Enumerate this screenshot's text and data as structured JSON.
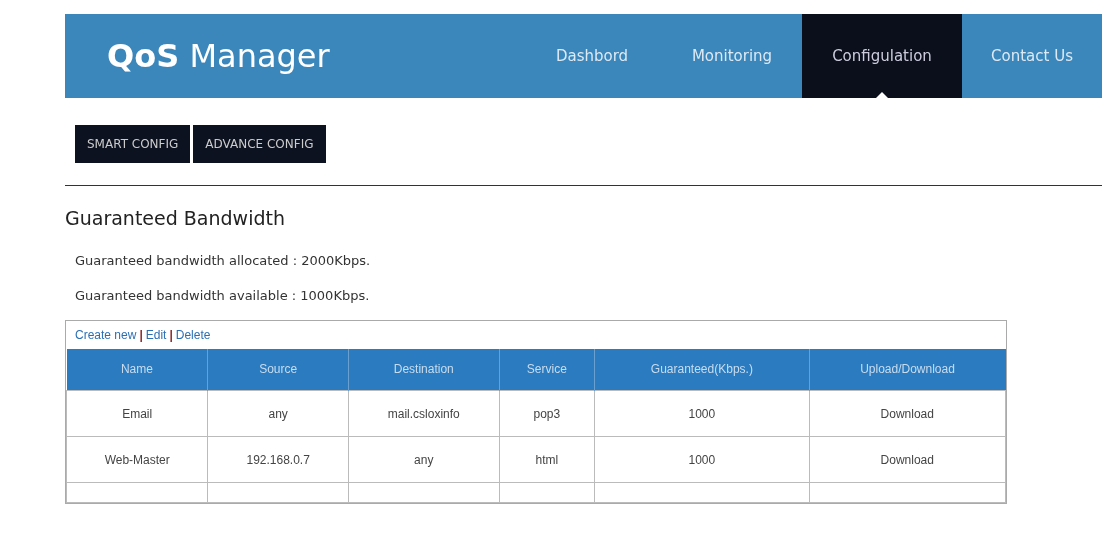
{
  "header": {
    "brand_bold": "QoS",
    "brand_light": "Manager",
    "nav": [
      {
        "label": "Dashbord",
        "selected": false
      },
      {
        "label": "Monitoring",
        "selected": false
      },
      {
        "label": "Configulation",
        "selected": true
      },
      {
        "label": "Contact Us",
        "selected": false
      }
    ]
  },
  "config_buttons": [
    "SMART CONFIG",
    "ADVANCE CONFIG"
  ],
  "section": {
    "title": "Guaranteed Bandwidth",
    "lines": [
      "Guaranteed bandwidth allocated : 2000Kbps.",
      "Guaranteed bandwidth available : 1000Kbps."
    ]
  },
  "table": {
    "actions": [
      {
        "label": "Create new"
      },
      {
        "label": "Edit"
      },
      {
        "label": "Delete"
      }
    ],
    "separators": [
      "|",
      "|"
    ],
    "columns": [
      "Name",
      "Source",
      "Destination",
      "Service",
      "Guaranteed(Kbps.)",
      "Upload/Download"
    ],
    "rows": [
      [
        "Email",
        "any",
        "mail.csloxinfo",
        "pop3",
        "1000",
        "Download"
      ],
      [
        "Web-Master",
        "192.168.0.7",
        "any",
        "html",
        "1000",
        "Download"
      ]
    ]
  }
}
